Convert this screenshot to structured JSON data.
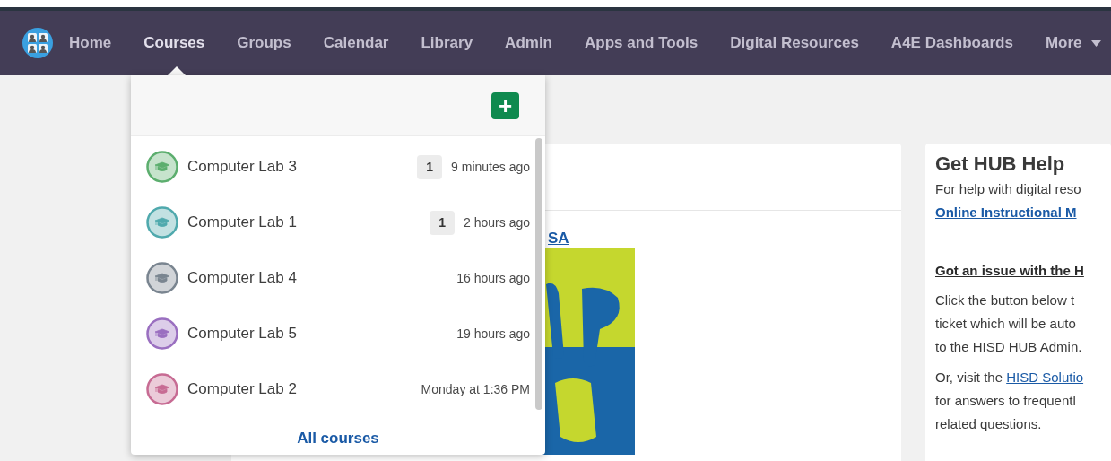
{
  "nav": {
    "items": [
      {
        "label": "Home",
        "selected": false
      },
      {
        "label": "Courses",
        "selected": true
      },
      {
        "label": "Groups",
        "selected": false
      },
      {
        "label": "Calendar",
        "selected": false
      },
      {
        "label": "Library",
        "selected": false
      },
      {
        "label": "Admin",
        "selected": false
      },
      {
        "label": "Apps and Tools",
        "selected": false
      },
      {
        "label": "Digital Resources",
        "selected": false
      },
      {
        "label": "A4E Dashboards",
        "selected": false
      },
      {
        "label": "More",
        "selected": false
      }
    ]
  },
  "courses_menu": {
    "add_button": "+",
    "courses": [
      {
        "name": "Computer Lab 3",
        "badge": "1",
        "time": "9 minutes ago",
        "color": "#5cae6e"
      },
      {
        "name": "Computer Lab 1",
        "badge": "1",
        "time": "2 hours ago",
        "color": "#4fa9ad"
      },
      {
        "name": "Computer Lab 4",
        "time": "16 hours ago",
        "color": "#7a8590"
      },
      {
        "name": "Computer Lab 5",
        "time": "19 hours ago",
        "color": "#9a6fc0"
      },
      {
        "name": "Computer Lab 2",
        "time": "Monday at 1:36 PM",
        "color": "#c76b93"
      }
    ],
    "footer_link": "All courses"
  },
  "main_card": {
    "link": "SA"
  },
  "help_card": {
    "title": "Get HUB Help",
    "intro": "For help with digital reso",
    "intro_link": "Online Instructional M",
    "issue_heading": "Got an issue with the H",
    "issue_lines": [
      "Click the button below t",
      "ticket which will be auto",
      "to the HISD HUB Admin."
    ],
    "visit_text": "Or, visit the ",
    "visit_link": "HISD Solutio",
    "visit_lines": [
      "for answers to frequentl",
      "related questions."
    ]
  }
}
